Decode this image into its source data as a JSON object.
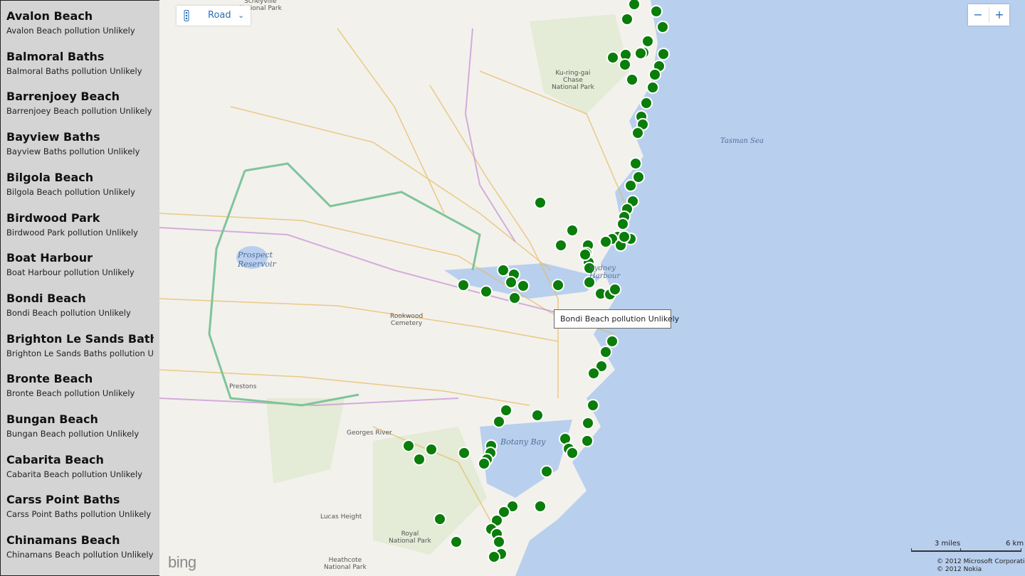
{
  "sidebar": {
    "items": [
      {
        "title": "Avalon Beach",
        "subtitle": "Avalon Beach pollution Unlikely"
      },
      {
        "title": "Balmoral Baths",
        "subtitle": "Balmoral Baths pollution Unlikely"
      },
      {
        "title": "Barrenjoey Beach",
        "subtitle": "Barrenjoey Beach pollution Unlikely"
      },
      {
        "title": "Bayview Baths",
        "subtitle": "Bayview Baths pollution Unlikely"
      },
      {
        "title": "Bilgola Beach",
        "subtitle": "Bilgola Beach pollution Unlikely"
      },
      {
        "title": "Birdwood Park",
        "subtitle": "Birdwood Park pollution Unlikely"
      },
      {
        "title": "Boat Harbour",
        "subtitle": "Boat Harbour pollution Unlikely"
      },
      {
        "title": "Bondi Beach",
        "subtitle": "Bondi Beach pollution Unlikely"
      },
      {
        "title": "Brighton Le Sands Baths",
        "subtitle": "Brighton Le Sands Baths pollution Unlikely"
      },
      {
        "title": "Bronte Beach",
        "subtitle": "Bronte Beach pollution Unlikely"
      },
      {
        "title": "Bungan Beach",
        "subtitle": "Bungan Beach pollution Unlikely"
      },
      {
        "title": "Cabarita Beach",
        "subtitle": "Cabarita Beach pollution Unlikely"
      },
      {
        "title": "Carss Point Baths",
        "subtitle": "Carss Point Baths pollution Unlikely"
      },
      {
        "title": "Chinamans Beach",
        "subtitle": "Chinamans Beach pollution Unlikely"
      }
    ]
  },
  "map_controls": {
    "map_type": "Road",
    "zoom_out": "−",
    "zoom_in": "+"
  },
  "tooltip": "Bondi Beach pollution Unlikely",
  "map_labels": {
    "scheyville": "Scheyville\nNational Park",
    "kuringgai": "Ku-ring-gai\nChase\nNational Park",
    "tasman": "Tasman Sea",
    "prospect": "Prospect\nReservoir",
    "sydney_harbour": "Sydney\nHarbour",
    "rookwood": "Rookwood\nCemetery",
    "prestons": "Prestons",
    "georges_river": "Georges River",
    "botany_bay": "Botany Bay",
    "lucas_height": "Lucas Height",
    "royal": "Royal\nNational Park",
    "heathcote": "Heathcote\nNational Park"
  },
  "scale": {
    "miles": "3 miles",
    "km": "6 km"
  },
  "copyright": [
    "© 2012 Microsoft Corporation",
    "© 2012 Nokia"
  ],
  "logo": "bing",
  "colors": {
    "marker": "#0a7d0a",
    "water": "#b9cfee",
    "land": "#f3f1ec",
    "sidebar": "#d4d4d4",
    "accent": "#2a6fb6"
  },
  "icons": {
    "map_type": "traffic-icon",
    "dropdown": "chevron-down-icon"
  }
}
